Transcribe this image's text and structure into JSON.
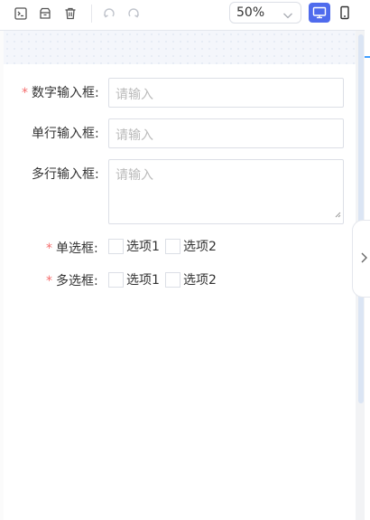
{
  "toolbar": {
    "icons": [
      "terminal-icon",
      "archive-icon",
      "trash-icon",
      "undo-icon",
      "redo-icon"
    ],
    "zoom": {
      "value": "50%"
    },
    "devices": [
      "desktop-icon",
      "mobile-icon"
    ],
    "accent_color": "#4f6bed"
  },
  "form": {
    "fields": {
      "number_input": {
        "label": "数字输入框:",
        "required": true,
        "placeholder": "请输入"
      },
      "single_line_input": {
        "label": "单行输入框:",
        "required": false,
        "placeholder": "请输入"
      },
      "multi_line_input": {
        "label": "多行输入框:",
        "required": false,
        "placeholder": "请输入"
      },
      "radio": {
        "label": "单选框:",
        "required": true,
        "options": [
          "选项1",
          "选项2"
        ]
      },
      "checkbox": {
        "label": "多选框:",
        "required": true,
        "options": [
          "选项1",
          "选项2"
        ]
      }
    },
    "required_mark": "*",
    "required_color": "#f56c6c"
  }
}
